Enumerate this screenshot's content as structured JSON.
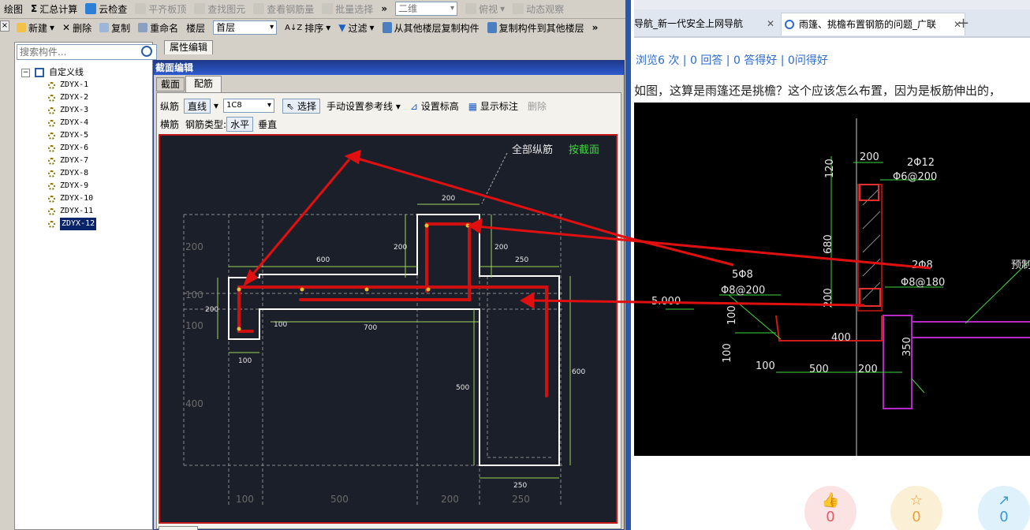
{
  "menu_bar": {
    "draw": "绘图",
    "sum": "汇总计算",
    "cloud_check": "云检查",
    "flat_top": "平齐板顶",
    "find": "查找图元",
    "view_rebar": "查看钢筋量",
    "batch_select": "批量选择",
    "more": "»",
    "view_mode": "二维",
    "top_view": "俯视",
    "dynamic": "动态观察"
  },
  "toolbar2": {
    "new": "新建",
    "delete": "删除",
    "copy": "复制",
    "rename": "重命名",
    "floor_label": "楼层",
    "floor_value": "首层",
    "sort": "排序",
    "filter": "过滤",
    "copy_from": "从其他楼层复制构件",
    "copy_to": "复制构件到其他楼层",
    "more": "»"
  },
  "search": {
    "placeholder": "搜索构件..."
  },
  "property_tab": "属性编辑",
  "tree": {
    "root": "自定义线",
    "items": [
      "ZDYX-1",
      "ZDYX-2",
      "ZDYX-3",
      "ZDYX-4",
      "ZDYX-5",
      "ZDYX-6",
      "ZDYX-7",
      "ZDYX-8",
      "ZDYX-9",
      "ZDYX-10",
      "ZDYX-11",
      "ZDYX-12"
    ],
    "selected_index": 11
  },
  "dialog": {
    "title": "截面编辑",
    "tabs": [
      "截面",
      "配筋"
    ],
    "active_tab": 1,
    "row1": {
      "longitudinal": "纵筋",
      "line_mode": "直线",
      "rebar_value": "1C8",
      "select": "选择",
      "manual_ref": "手动设置参考线",
      "set_elev": "设置标高",
      "show_mark": "显示标注",
      "remove": "删除"
    },
    "row2": {
      "transverse": "横筋",
      "type_label": "钢筋类型:",
      "horizontal": "水平",
      "vertical": "垂直"
    },
    "canvas": {
      "top_label_all": "全部纵筋",
      "top_label_section": "按截面",
      "dims": {
        "d200_top": "200",
        "d200_left": "200",
        "d200_right": "200",
        "d600_top": "600",
        "d250_top": "250",
        "d200_y": "200",
        "d100_a": "100",
        "d100_b": "100",
        "d100_c": "100",
        "d700": "700",
        "d100_bottom": "100",
        "d500_vert": "500",
        "d600_vert": "600",
        "d250_bottom": "250",
        "d400_left": "400",
        "g100": "100",
        "g500": "500",
        "g200": "200",
        "g250": "250",
        "g200_left": "200"
      }
    }
  },
  "browser": {
    "tab1": "导航_新一代安全上网导航",
    "tab2": "雨篷、挑檐布置钢筋的问题_广联",
    "stats": "浏览6 次 | 0 回答 | 0 答得好 | 0问得好",
    "question": "如图，这算是雨篷还是挑檐？这个应该怎么布置，因为是板筋伸出的，",
    "actions": [
      {
        "icon": "thumbs-up-icon",
        "count": "0"
      },
      {
        "icon": "star-icon",
        "count": "0"
      },
      {
        "icon": "share-icon",
        "count": "0"
      }
    ]
  },
  "cad": {
    "t200_top": "200",
    "t2phi12": "2Φ12",
    "tphi6": "Φ6@200",
    "t120": "120",
    "t680": "680",
    "t200_v": "200",
    "t2phi8": "2Φ8",
    "tphi8_180": "Φ8@180",
    "t5phi8": "5Φ8",
    "tphi8_200": "Φ8@200",
    "t5000": "5.000",
    "t100_a": "100",
    "t100_b": "100",
    "t400": "400",
    "t100_c": "100",
    "t500": "500",
    "t200_b": "200",
    "t350": "350",
    "tyuzhi": "预制"
  },
  "colors": {
    "canvas_bg": "#1b1f2a",
    "rebar": "#d01010",
    "dim": "#9fd35a",
    "cad_bg": "#000000",
    "accent_link": "#2a6ad3"
  }
}
